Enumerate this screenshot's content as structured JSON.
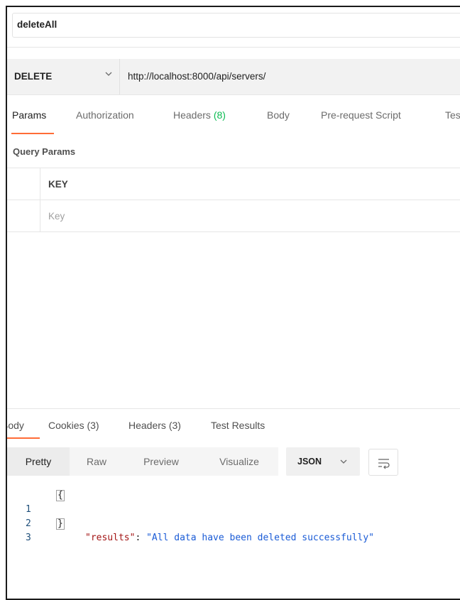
{
  "request": {
    "name": "deleteAll",
    "method": "DELETE",
    "url": "http://localhost:8000/api/servers/"
  },
  "request_tabs": [
    {
      "label": "Params",
      "count": ""
    },
    {
      "label": "Authorization",
      "count": ""
    },
    {
      "label": "Headers ",
      "count": "(8)"
    },
    {
      "label": "Body",
      "count": ""
    },
    {
      "label": "Pre-request Script",
      "count": ""
    },
    {
      "label": "Tes",
      "count": ""
    }
  ],
  "query_params": {
    "section_label": "Query Params",
    "key_header": "KEY",
    "key_placeholder": "Key"
  },
  "response_tabs": [
    {
      "label": "Body",
      "count": ""
    },
    {
      "label": "Cookies ",
      "count": "(3)"
    },
    {
      "label": "Headers ",
      "count": "(3)"
    },
    {
      "label": "Test Results",
      "count": ""
    }
  ],
  "response_view": {
    "modes": [
      "Pretty",
      "Raw",
      "Preview",
      "Visualize"
    ],
    "format": "JSON"
  },
  "response_body": {
    "line_numbers": [
      "1",
      "2",
      "3"
    ],
    "open_brace": "{",
    "close_brace": "}",
    "key": "\"results\"",
    "colon": ": ",
    "value": "\"All data have been deleted successfully\""
  },
  "colors": {
    "accent": "#ff6c37",
    "count_green": "#0cbb52",
    "json_key": "#a31515",
    "json_value": "#1a5bd6"
  }
}
